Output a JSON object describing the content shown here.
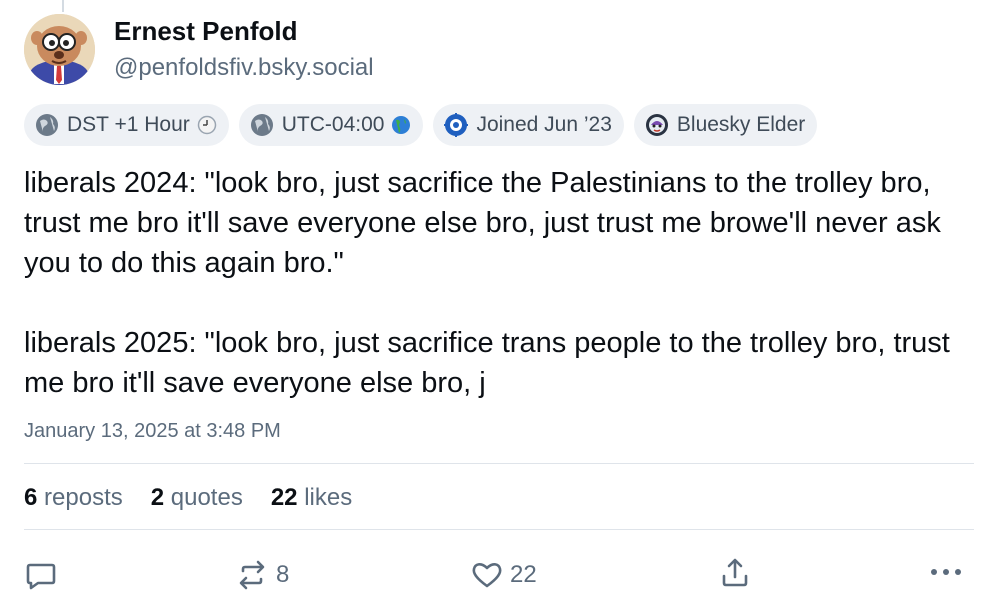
{
  "author": {
    "display_name": "Ernest Penfold",
    "handle": "@penfoldsfiv.bsky.social"
  },
  "badges": [
    {
      "label": "DST +1 Hour",
      "icon": "globe-icon",
      "trailing_icon": "clock-icon"
    },
    {
      "label": "UTC-04:00",
      "icon": "globe-icon",
      "trailing_icon": "earth-americas-icon"
    },
    {
      "label": "Joined Jun ’23",
      "icon": "calendar-badge-icon"
    },
    {
      "label": "Bluesky Elder",
      "icon": "elder-avatar-icon"
    }
  ],
  "post": {
    "text": "liberals 2024: \"look bro, just sacrifice the Palestinians to the trolley bro, trust me bro it'll save everyone else bro, just trust me browe'll never ask you to do this again bro.\"\n\nliberals 2025: \"look bro, just sacrifice trans people to the trolley bro, trust me bro it'll save everyone else bro, j",
    "timestamp": "January 13, 2025 at 3:48 PM"
  },
  "stats": {
    "reposts_count": "6",
    "reposts_label": "reposts",
    "quotes_count": "2",
    "quotes_label": "quotes",
    "likes_count": "22",
    "likes_label": "likes"
  },
  "actions": {
    "repost_count": "8",
    "like_count": "22"
  },
  "colors": {
    "muted": "#5b6b7c",
    "badge_bg": "#eef1f5",
    "divider": "#dfe4ea"
  }
}
